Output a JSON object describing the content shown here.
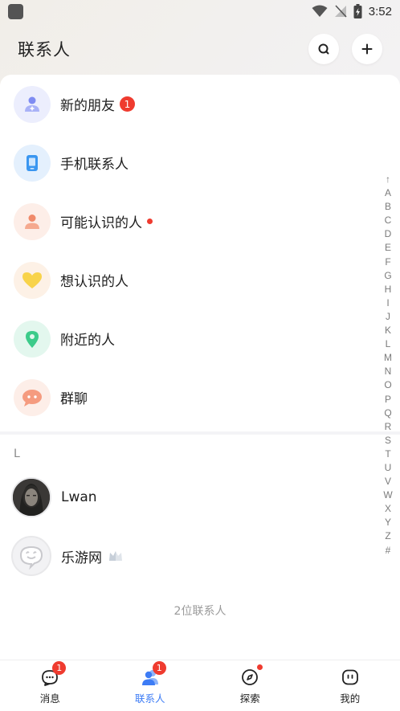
{
  "status_bar": {
    "time": "3:52"
  },
  "header": {
    "title": "联系人"
  },
  "menu": [
    {
      "label": "新的朋友",
      "badge": "1",
      "icon": "add-user-icon"
    },
    {
      "label": "手机联系人",
      "icon": "phone-icon"
    },
    {
      "label": "可能认识的人",
      "icon": "person-icon"
    },
    {
      "label": "想认识的人",
      "icon": "heart-icon"
    },
    {
      "label": "附近的人",
      "icon": "location-icon"
    },
    {
      "label": "群聊",
      "icon": "group-chat-icon"
    }
  ],
  "section": {
    "letter": "L"
  },
  "contacts": [
    {
      "name": "Lwan",
      "icon": "avatar"
    },
    {
      "name": "乐游网",
      "icon": "avatar"
    }
  ],
  "contact_count": "2位联系人",
  "alpha_index": [
    "↑",
    "A",
    "B",
    "C",
    "D",
    "E",
    "F",
    "G",
    "H",
    "I",
    "J",
    "K",
    "L",
    "M",
    "N",
    "O",
    "P",
    "Q",
    "R",
    "S",
    "T",
    "U",
    "V",
    "W",
    "X",
    "Y",
    "Z",
    "#"
  ],
  "tabs": [
    {
      "label": "消息",
      "badge": "1"
    },
    {
      "label": "联系人",
      "badge": "1"
    },
    {
      "label": "探索"
    },
    {
      "label": "我的"
    }
  ],
  "colors": {
    "accent": "#3d7cf5",
    "badge": "#ef3b2f"
  }
}
